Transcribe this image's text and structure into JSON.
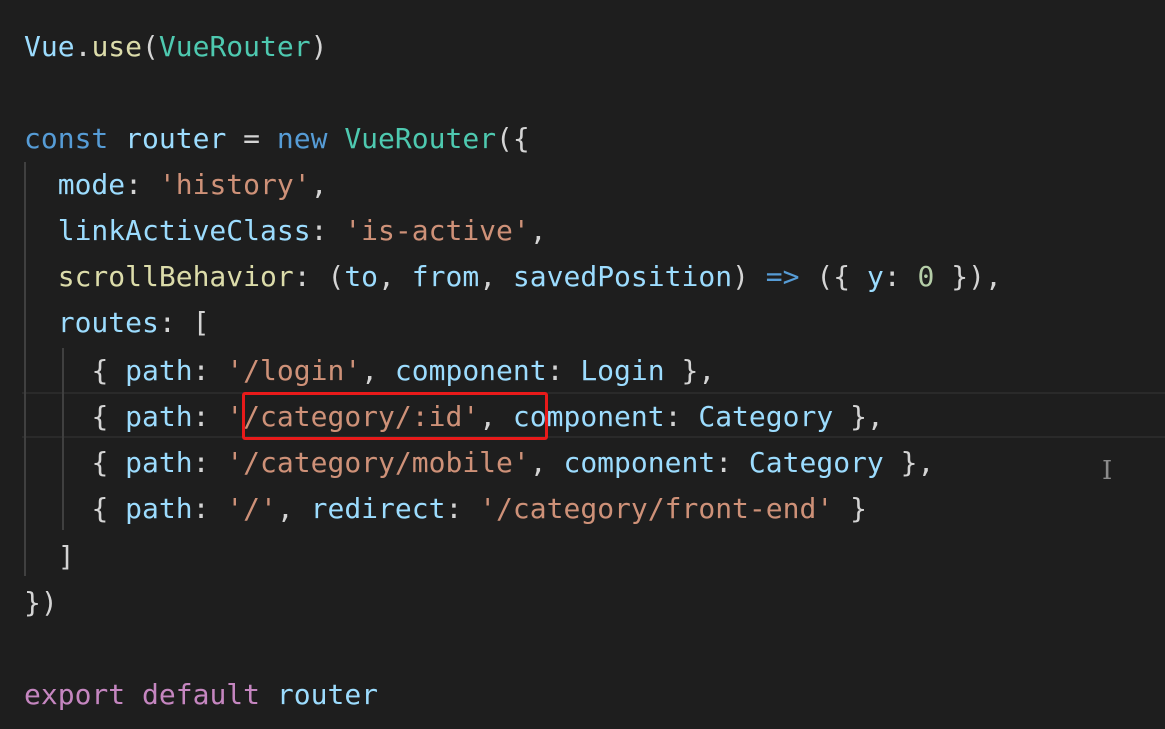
{
  "code": {
    "l1": {
      "obj": "Vue",
      "dot": ".",
      "method": "use",
      "open": "(",
      "arg": "VueRouter",
      "close": ")"
    },
    "l3": {
      "kw": "const",
      "name": "router",
      "eq": "=",
      "new": "new",
      "cls": "VueRouter",
      "open": "({"
    },
    "l4": {
      "key": "mode",
      "colon": ":",
      "val": "'history'",
      "comma": ","
    },
    "l5": {
      "key": "linkActiveClass",
      "colon": ":",
      "val": "'is-active'",
      "comma": ","
    },
    "l6": {
      "key": "scrollBehavior",
      "colon": ":",
      "open": "(",
      "p1": "to",
      "c1": ",",
      "p2": "from",
      "c2": ",",
      "p3": "savedPosition",
      "close": ")",
      "arrow": "=>",
      "body_open": "({",
      "y": "y",
      "colon2": ":",
      "zero": "0",
      "body_close": "}),"
    },
    "l7": {
      "key": "routes",
      "colon": ":",
      "bracket": "["
    },
    "l8": {
      "open": "{",
      "path": "path",
      "c1": ":",
      "val": "'/login'",
      "comma": ",",
      "comp": "component",
      "c2": ":",
      "compval": "Login",
      "close": "},"
    },
    "l9": {
      "open": "{",
      "path": "path",
      "c1": ":",
      "val": "'/category/:id'",
      "comma": ",",
      "comp": "component",
      "c2": ":",
      "compval": "Category",
      "close": "},"
    },
    "l10": {
      "open": "{",
      "path": "path",
      "c1": ":",
      "val": "'/category/mobile'",
      "comma": ",",
      "comp": "component",
      "c2": ":",
      "compval": "Category",
      "close": "},"
    },
    "l11": {
      "open": "{",
      "path": "path",
      "c1": ":",
      "val": "'/'",
      "comma": ",",
      "redir": "redirect",
      "c2": ":",
      "redirval": "'/category/front-end'",
      "close": "}"
    },
    "l12": {
      "bracket": "]"
    },
    "l13": {
      "close": "})"
    },
    "l15": {
      "export": "export",
      "default": "default",
      "name": "router"
    }
  },
  "colors": {
    "background": "#1e1e1e",
    "keyword": "#569cd6",
    "control_keyword": "#c586c0",
    "class": "#4ec9b0",
    "function": "#dcdcaa",
    "property": "#9cdcfe",
    "string": "#ce9178",
    "number": "#b5cea8",
    "highlight_box": "#e81a1a"
  },
  "icons": {
    "mouse_cursor": "text-cursor-icon"
  }
}
